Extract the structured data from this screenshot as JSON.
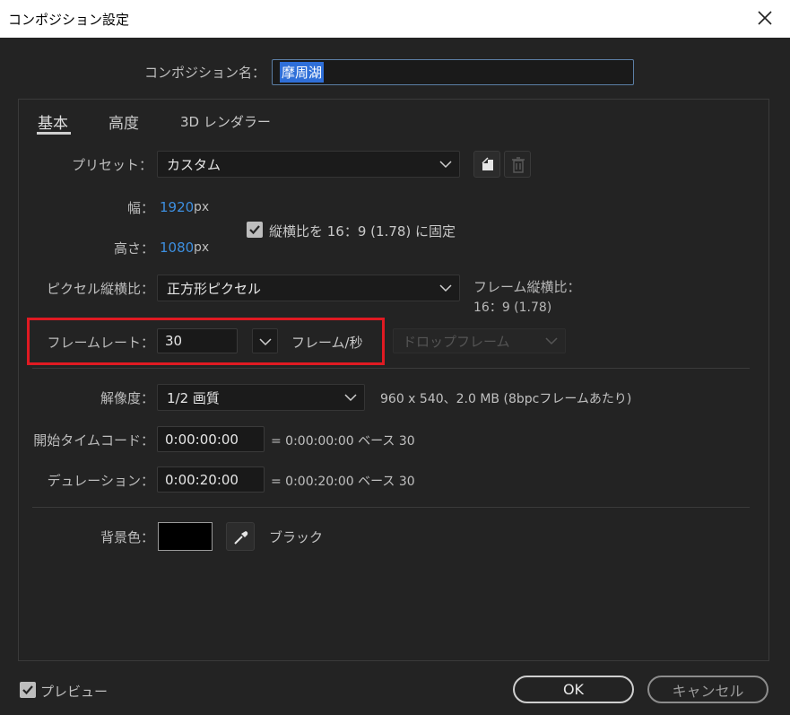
{
  "window": {
    "title": "コンポジション設定"
  },
  "comp_name": {
    "label": "コンポジション名：",
    "value": "摩周湖"
  },
  "tabs": [
    {
      "label": "基本"
    },
    {
      "label": "高度"
    },
    {
      "label": "3D レンダラー"
    }
  ],
  "preset": {
    "label": "プリセット：",
    "value": "カスタム"
  },
  "width": {
    "label": "幅：",
    "value": "1920",
    "unit": "px"
  },
  "height": {
    "label": "高さ：",
    "value": "1080",
    "unit": "px"
  },
  "aspect_lock": {
    "label": "縦横比を 16：9 (1.78) に固定",
    "checked": true
  },
  "pixel_aspect": {
    "label": "ピクセル縦横比：",
    "value": "正方形ピクセル"
  },
  "frame_aspect": {
    "label": "フレーム縦横比：",
    "value": "16：9 (1.78)"
  },
  "frame_rate": {
    "label": "フレームレート：",
    "value": "30",
    "unit": "フレーム/秒",
    "dropframe": "ドロップフレーム"
  },
  "resolution": {
    "label": "解像度：",
    "value": "1/2 画質",
    "info": "960 x 540、2.0 MB (8bpcフレームあたり)"
  },
  "start_timecode": {
    "label": "開始タイムコード：",
    "value": "0:00:00:00",
    "info": "= 0:00:00:00  ベース 30"
  },
  "duration": {
    "label": "デュレーション：",
    "value": "0:00:20:00",
    "info": "= 0:00:20:00  ベース 30"
  },
  "bg_color": {
    "label": "背景色：",
    "name": "ブラック",
    "color": "#000000"
  },
  "preview": {
    "label": "プレビュー",
    "checked": true
  },
  "buttons": {
    "ok": "OK",
    "cancel": "キャンセル"
  },
  "colors": {
    "accent_blue": "#3d8fe0",
    "highlight": "#e01a22",
    "selection": "#2f6fd8"
  }
}
